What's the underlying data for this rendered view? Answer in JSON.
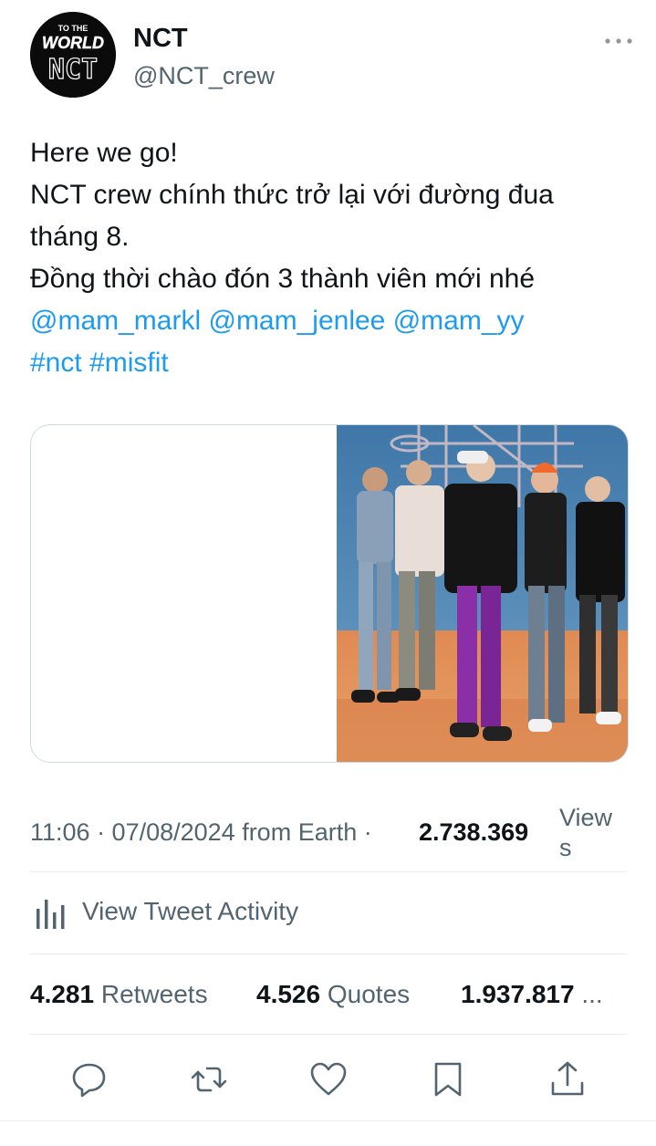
{
  "tweet": {
    "author_name": "NCT",
    "author_handle": "@NCT_crew",
    "avatar_text_top": "TO THE",
    "avatar_text_mid": "WORLD",
    "avatar_text_bottom": "NCT",
    "text_lines": [
      "Here we go!",
      "NCT crew chính thức trở lại với đường đua",
      "tháng 8.",
      "Đồng thời chào đón 3 thành viên mới nhé"
    ],
    "mentions": [
      "@mam_markl",
      "@mam_jenlee",
      "@mam_yy"
    ],
    "hashtags": [
      "#nct",
      "#misfit"
    ],
    "timestamp": "11:06 · 07/08/2024 from Earth ·",
    "views_count": "2.738.369",
    "views_label": "Views"
  },
  "activity": {
    "label": "View Tweet Activity"
  },
  "stats": {
    "retweets_count": "4.281",
    "retweets_label": "Retweets",
    "quotes_count": "4.526",
    "quotes_label": "Quotes",
    "likes_count": "1.937.817",
    "likes_ellipsis": "..."
  },
  "colors": {
    "link": "#1d9bf0",
    "secondary_text": "#536471",
    "primary_text": "#0f1419"
  },
  "icons": {
    "more": "more-dots-icon",
    "activity": "bar-chart-icon",
    "reply": "reply-icon",
    "retweet": "retweet-icon",
    "like": "heart-icon",
    "bookmark": "bookmark-icon",
    "share": "share-icon"
  }
}
